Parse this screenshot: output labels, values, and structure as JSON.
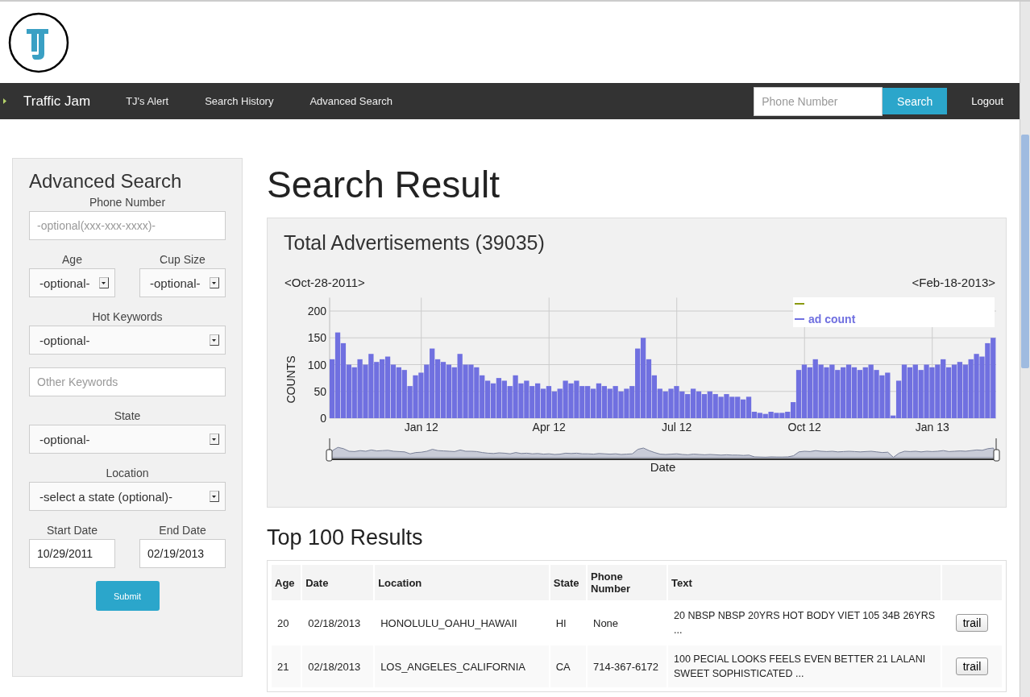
{
  "navbar": {
    "brand": "Traffic Jam",
    "links": [
      "TJ's Alert",
      "Search History",
      "Advanced Search"
    ],
    "search": {
      "placeholder": "Phone Number",
      "button": "Search"
    },
    "logout": "Logout"
  },
  "advanced_search": {
    "title": "Advanced Search",
    "rows": [
      [
        {
          "kind": "text",
          "label": "Phone Number",
          "placeholder": "-optional(xxx-xxx-xxxx)-"
        }
      ],
      [
        {
          "kind": "select",
          "label": "Age",
          "value": "-optional-"
        },
        {
          "kind": "select",
          "label": "Cup Size",
          "value": "-optional-"
        }
      ],
      [
        {
          "kind": "select",
          "label": "Hot Keywords",
          "value": "-optional-"
        }
      ],
      [
        {
          "kind": "text",
          "placeholder": "Other Keywords"
        }
      ],
      [
        {
          "kind": "select",
          "label": "State",
          "value": "-optional-"
        }
      ],
      [
        {
          "kind": "select",
          "label": "Location",
          "value": "-select a state (optional)-"
        }
      ],
      [
        {
          "kind": "text",
          "label": "Start Date",
          "value": "10/29/2011"
        },
        {
          "kind": "text",
          "label": "End Date",
          "value": "02/19/2013"
        }
      ]
    ],
    "submit": "Submit"
  },
  "page_title": "Search Result",
  "chart_panel": {
    "title": "Total Advertisements (39035)",
    "range_start": "<Oct-28-2011>",
    "range_end": "<Feb-18-2013>",
    "chart_data": {
      "type": "bar",
      "xlabel": "Date",
      "ylabel": "COUNTS",
      "ylim": [
        0,
        225
      ],
      "yticks": [
        0,
        50,
        100,
        150,
        200
      ],
      "grid": true,
      "categories": [
        null,
        null,
        null,
        null,
        null,
        null,
        null,
        null,
        null,
        null,
        null,
        null,
        null,
        null,
        null,
        null,
        "Jan 12",
        null,
        null,
        null,
        null,
        null,
        null,
        null,
        null,
        null,
        null,
        null,
        null,
        null,
        null,
        null,
        null,
        null,
        null,
        null,
        null,
        null,
        null,
        "Apr 12",
        null,
        null,
        null,
        null,
        null,
        null,
        null,
        null,
        null,
        null,
        null,
        null,
        null,
        null,
        null,
        null,
        null,
        null,
        null,
        null,
        null,
        null,
        "Jul 12",
        null,
        null,
        null,
        null,
        null,
        null,
        null,
        null,
        null,
        null,
        null,
        null,
        null,
        null,
        null,
        null,
        null,
        null,
        null,
        null,
        null,
        null,
        "Oct 12",
        null,
        null,
        null,
        null,
        null,
        null,
        null,
        null,
        null,
        null,
        null,
        null,
        null,
        null,
        null,
        null,
        null,
        null,
        null,
        null,
        null,
        null,
        "Jan 13",
        null,
        null,
        null,
        null,
        null,
        null,
        null,
        null,
        null,
        null,
        null
      ],
      "series": [
        {
          "name": "ad count",
          "color": "#7070e0",
          "values": [
            110,
            160,
            140,
            100,
            95,
            110,
            100,
            120,
            105,
            110,
            115,
            100,
            95,
            90,
            60,
            80,
            85,
            100,
            130,
            110,
            105,
            100,
            95,
            120,
            100,
            100,
            95,
            80,
            70,
            65,
            75,
            70,
            60,
            80,
            65,
            70,
            60,
            65,
            55,
            60,
            50,
            55,
            70,
            65,
            70,
            60,
            60,
            55,
            65,
            60,
            55,
            60,
            50,
            55,
            60,
            130,
            150,
            110,
            80,
            55,
            50,
            55,
            60,
            50,
            45,
            55,
            50,
            45,
            50,
            45,
            40,
            45,
            40,
            40,
            35,
            40,
            12,
            10,
            8,
            12,
            10,
            10,
            12,
            30,
            90,
            100,
            95,
            110,
            100,
            95,
            100,
            90,
            95,
            100,
            95,
            90,
            95,
            100,
            90,
            80,
            85,
            5,
            70,
            100,
            95,
            100,
            90,
            100,
            95,
            100,
            110,
            95,
            100,
            105,
            100,
            110,
            120,
            115,
            140,
            150
          ]
        }
      ]
    }
  },
  "results": {
    "title": "Top 100 Results",
    "columns": [
      "Age",
      "Date",
      "Location",
      "State",
      "Phone Number",
      "Text"
    ],
    "rows": [
      {
        "cells": [
          "20",
          "02/18/2013",
          "HONOLULU_OAHU_HAWAII",
          "HI",
          "None",
          "20 NBSP NBSP 20YRS HOT BODY VIET 105 34B 26YRS ..."
        ],
        "button": "trail"
      },
      {
        "cells": [
          "21",
          "02/18/2013",
          "LOS_ANGELES_CALIFORNIA",
          "CA",
          "714-367-6172",
          "100 PECIAL LOOKS FEELS EVEN BETTER 21 LALANI SWEET SOPHISTICATED ..."
        ],
        "button": "trail"
      }
    ]
  }
}
